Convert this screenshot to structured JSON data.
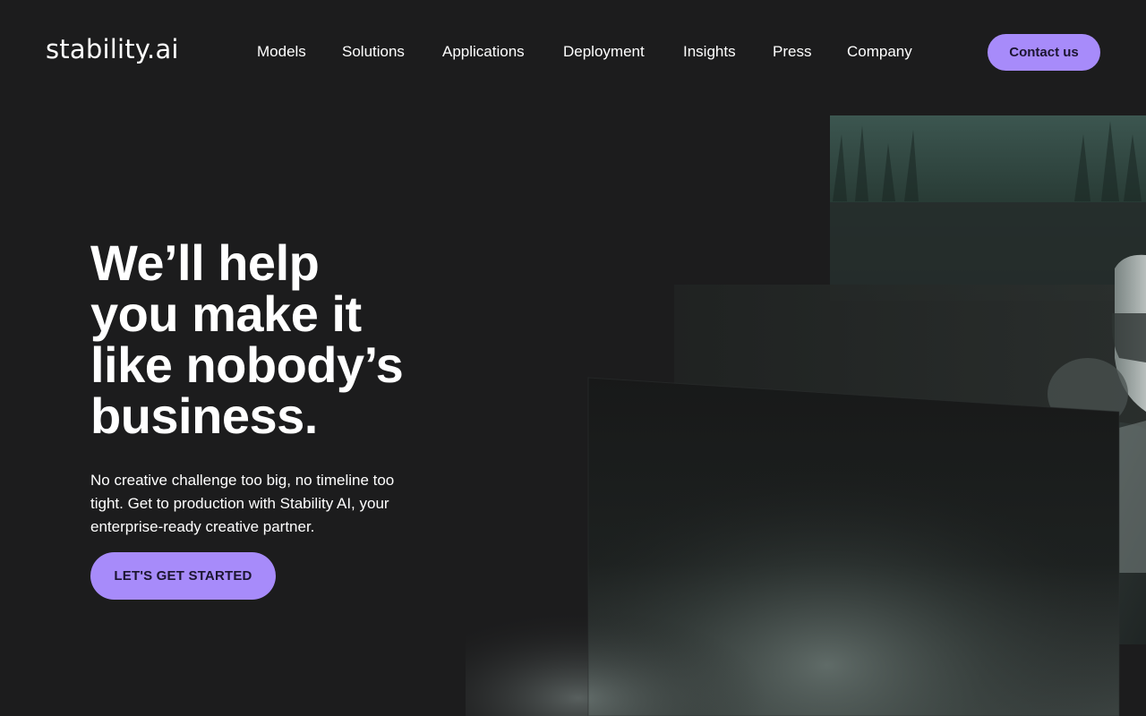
{
  "brand": {
    "logo_text": "stability.ai"
  },
  "nav": {
    "items": [
      {
        "label": "Models"
      },
      {
        "label": "Solutions"
      },
      {
        "label": "Applications"
      },
      {
        "label": "Deployment"
      },
      {
        "label": "Insights"
      },
      {
        "label": "Press"
      },
      {
        "label": "Company"
      }
    ],
    "contact_label": "Contact us"
  },
  "hero": {
    "title_lines": [
      "We’ll help",
      "you make it",
      "like nobody’s",
      "business."
    ],
    "description": "No creative challenge too big, no timeline too tight. Get to production with Stability AI, your enterprise-ready creative partner.",
    "cta_label": "LET'S GET STARTED"
  },
  "colors": {
    "background": "#1c1c1d",
    "accent": "#a78bfa",
    "text": "#ffffff",
    "button_text": "#1b1530"
  }
}
